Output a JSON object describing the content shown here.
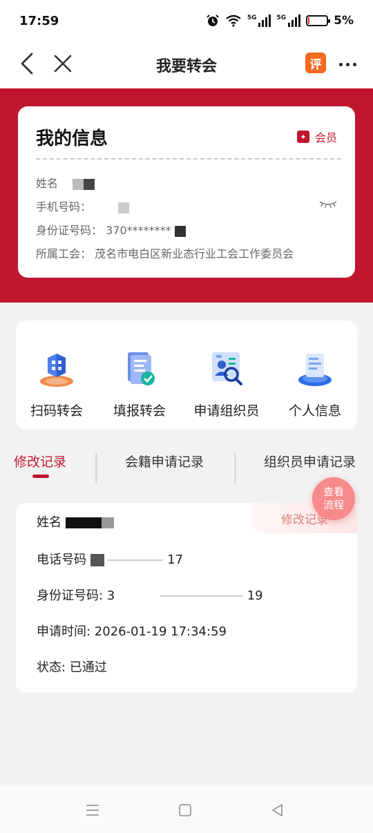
{
  "status_bar": {
    "time": "17:59",
    "network_labels": [
      "5G",
      "5G"
    ],
    "battery_percent": "5%",
    "battery_level": 0.05,
    "icons": [
      "alarm-icon",
      "wifi-icon",
      "signal-icon",
      "battery-icon"
    ]
  },
  "nav": {
    "title": "我要转会",
    "rate_label": "评",
    "icons": [
      "back-icon",
      "close-icon",
      "rate-icon",
      "more-icon"
    ]
  },
  "my_info": {
    "title": "我的信息",
    "member_label": "会员",
    "rows": [
      {
        "label": "姓名",
        "value": ""
      },
      {
        "label": "手机号码：",
        "value": ""
      },
      {
        "label": "身份证号码：",
        "value": "370********"
      },
      {
        "label": "所属工会：",
        "value": "茂名市电白区新业态行业工会工作委员会"
      }
    ]
  },
  "actions": [
    {
      "label": "扫码转会",
      "icon": "scan-transfer-icon"
    },
    {
      "label": "填报转会",
      "icon": "form-transfer-icon"
    },
    {
      "label": "申请组织员",
      "icon": "apply-organizer-icon"
    },
    {
      "label": "个人信息",
      "icon": "personal-info-icon"
    }
  ],
  "tabs": [
    {
      "label": "修改记录",
      "active": true
    },
    {
      "label": "会籍申请记录",
      "active": false
    },
    {
      "label": "组织员申请记录",
      "active": false
    }
  ],
  "record": {
    "tag": "修改记录",
    "name_label": "姓名",
    "phone_label": "电话号码",
    "phone_value": "17",
    "id_label": "身份证号码: ",
    "id_value": "3",
    "id_tail": "19",
    "time_label": "申请时间: ",
    "time_value": "2026-01-19 17:34:59",
    "status_label": "状态: ",
    "status_value": "已通过"
  },
  "fab_label": "查看\n流程",
  "fab_lines": [
    "查看",
    "流程"
  ],
  "colors": {
    "brand_red": "#c0172f",
    "fab_pink": "#f78a8a",
    "page_bg": "#f2f2f2"
  }
}
